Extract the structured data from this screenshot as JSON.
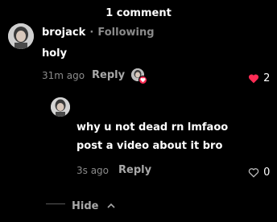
{
  "header": {
    "title": "1 comment"
  },
  "comment": {
    "username": "brojack",
    "separator": "·",
    "relation": "Following",
    "text": "holy",
    "time": "31m ago",
    "reply_label": "Reply",
    "like_count": "2",
    "like_color": "#fe2c55"
  },
  "reply": {
    "text": "why u not dead rn lmfaoo post a video about it bro",
    "time": "3s ago",
    "reply_label": "Reply",
    "like_count": "0"
  },
  "footer": {
    "hide_label": "Hide"
  }
}
